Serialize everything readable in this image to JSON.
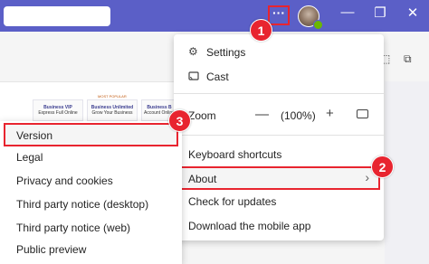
{
  "title_bar": {
    "more_options_label": "···",
    "window_controls": {
      "minimize": "—",
      "maximize": "❐",
      "close": "✕"
    }
  },
  "callouts": {
    "one": "1",
    "two": "2",
    "three": "3"
  },
  "background": {
    "badge": "MOST POPULAR",
    "plans": [
      {
        "name": "Business VIP",
        "tagline": "Express Full Online"
      },
      {
        "name": "Business Unlimited",
        "tagline": "Grow Your Business"
      },
      {
        "name": "Business B",
        "tagline": "Account Online"
      }
    ]
  },
  "main_menu": {
    "settings": "Settings",
    "cast": "Cast",
    "zoom_label": "Zoom",
    "zoom_minus": "—",
    "zoom_value": "(100%)",
    "zoom_plus": "+",
    "keyboard_shortcuts": "Keyboard shortcuts",
    "about": "About",
    "about_chevron": "›",
    "check_updates": "Check for updates",
    "download_mobile": "Download the mobile app"
  },
  "about_submenu": {
    "version": "Version",
    "legal": "Legal",
    "privacy": "Privacy and cookies",
    "third_party_desktop": "Third party notice (desktop)",
    "third_party_web": "Third party notice (web)",
    "public_preview": "Public preview"
  },
  "icons": {
    "settings": "gear-icon",
    "cast": "cast-icon",
    "zoom_fit": "fit-to-screen-icon"
  },
  "colors": {
    "title_bar": "#5b5fc7",
    "highlight": "#e8242f",
    "presence": "#6bb700"
  }
}
